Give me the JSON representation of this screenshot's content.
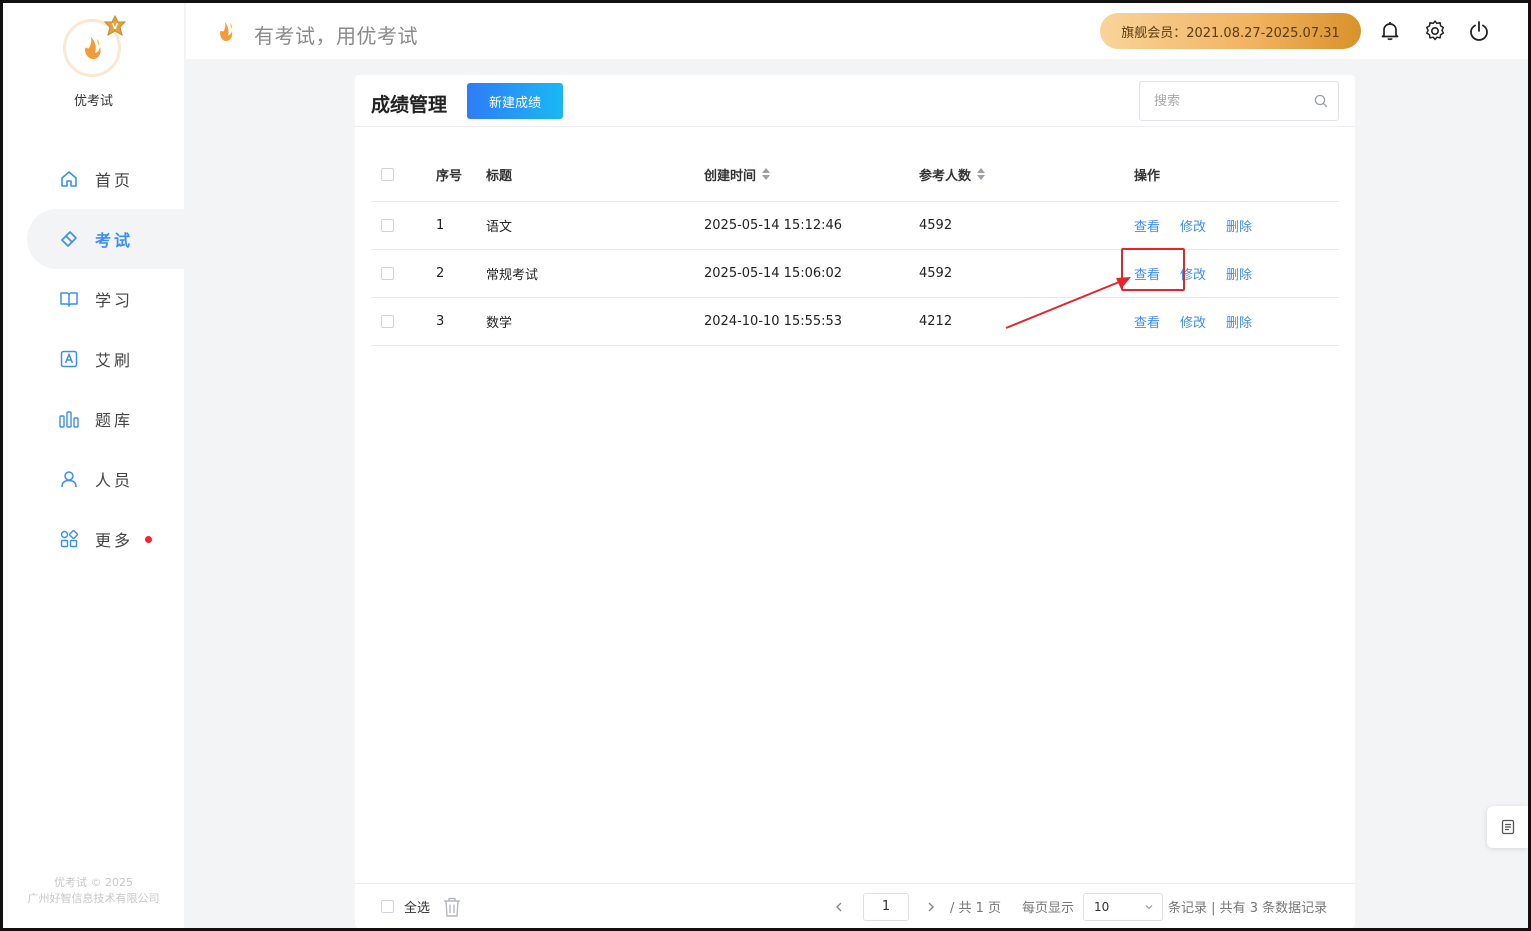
{
  "sidebar": {
    "brand_name": "优考试",
    "items": [
      {
        "key": "home",
        "label": "首页",
        "icon": "home-icon"
      },
      {
        "key": "exam",
        "label": "考试",
        "icon": "eraser-icon",
        "active": true
      },
      {
        "key": "study",
        "label": "学习",
        "icon": "book-icon"
      },
      {
        "key": "brush",
        "label": "艾刷",
        "icon": "letter-a-icon"
      },
      {
        "key": "bank",
        "label": "题库",
        "icon": "bars-icon"
      },
      {
        "key": "people",
        "label": "人员",
        "icon": "user-icon"
      },
      {
        "key": "more",
        "label": "更多",
        "icon": "apps-icon",
        "badge_dot": true
      }
    ],
    "copyright_line1": "优考试 © 2025",
    "copyright_line2": "广州好智信息技术有限公司"
  },
  "header": {
    "slogan": "有考试，用优考试",
    "vip_label": "旗舰会员：2021.08.27-2025.07.31",
    "icons": [
      "bell-icon",
      "gear-icon",
      "power-icon"
    ]
  },
  "page": {
    "title": "成绩管理",
    "new_button": "新建成绩",
    "search_placeholder": "搜索"
  },
  "table": {
    "headers": {
      "index": "序号",
      "title": "标题",
      "created": "创建时间",
      "participants": "参考人数",
      "actions": "操作"
    },
    "rows": [
      {
        "index": "1",
        "title": "语文",
        "created": "2025-05-14 15:12:46",
        "participants": "4592"
      },
      {
        "index": "2",
        "title": "常规考试",
        "created": "2025-05-14 15:06:02",
        "participants": "4592"
      },
      {
        "index": "3",
        "title": "数学",
        "created": "2024-10-10 15:55:53",
        "participants": "4212"
      }
    ],
    "action_labels": {
      "view": "查看",
      "edit": "修改",
      "delete": "删除"
    }
  },
  "footer": {
    "select_all": "全选",
    "current_page": "1",
    "total_pages_text": "/ 共 1 页",
    "per_page_label": "每页显示",
    "per_page_value": "10",
    "records_text": "条记录 | 共有 3 条数据记录"
  },
  "colors": {
    "accent": "#3b8ff0",
    "highlight": "#e5252a",
    "vip_gold": "#f0b25f"
  }
}
